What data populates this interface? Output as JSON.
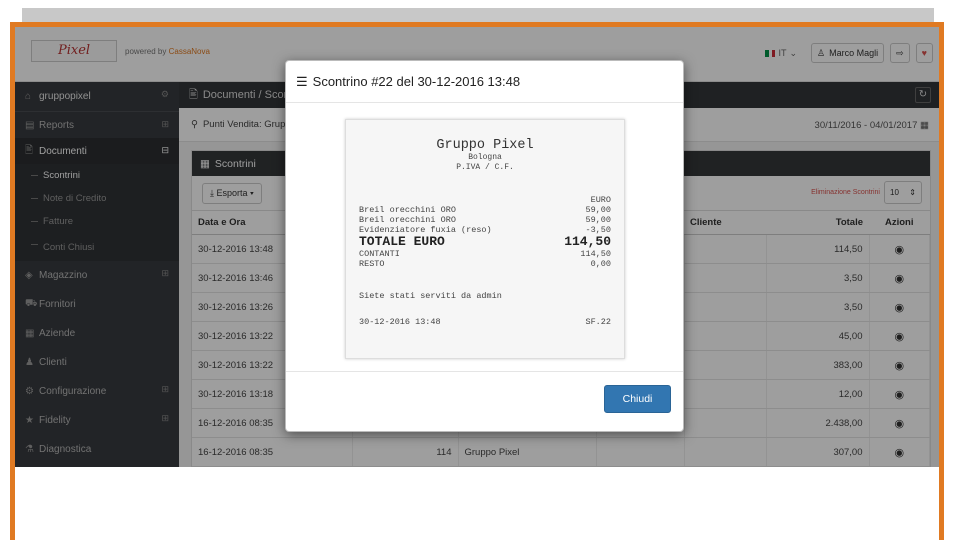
{
  "header": {
    "logo": "Pixel",
    "powered_by": "powered by ",
    "powered_brand": "CassaNova",
    "lang": "IT",
    "user": "Marco Magli"
  },
  "sidebar": {
    "company": "gruppopixel",
    "items": [
      {
        "label": "Reports",
        "icon": "chart-icon"
      },
      {
        "label": "Documenti",
        "icon": "document-icon"
      }
    ],
    "subitems": [
      "Scontrini",
      "Note di Credito",
      "Fatture",
      "Conti Chiusi"
    ],
    "items2": [
      {
        "label": "Magazzino",
        "icon": "boxes-icon",
        "expand": true
      },
      {
        "label": "Fornitori",
        "icon": "truck-icon",
        "expand": false
      },
      {
        "label": "Aziende",
        "icon": "building-icon",
        "expand": false
      },
      {
        "label": "Clienti",
        "icon": "users-icon",
        "expand": false
      },
      {
        "label": "Configurazione",
        "icon": "cogs-icon",
        "expand": true
      },
      {
        "label": "Fidelity",
        "icon": "star-icon",
        "expand": true
      },
      {
        "label": "Diagnostica",
        "icon": "diagnostic-icon",
        "expand": false
      }
    ]
  },
  "content": {
    "breadcrumb": "Documenti / Scontrini",
    "filter_label": "Punti Vendita: Gruppo Pixel",
    "date_range": "30/11/2016 - 04/01/2017",
    "panel_title": "Scontrini",
    "export_label": "Esporta",
    "delete_label": "Eliminazione Scontrini",
    "page_size": "10",
    "columns": [
      "Data e Ora",
      "",
      "",
      "",
      "Cliente",
      "Totale",
      "Azioni"
    ],
    "rows": [
      {
        "date": "30-12-2016 13:48",
        "num": "",
        "pv": "",
        "x": "",
        "client": "",
        "total": "114,50"
      },
      {
        "date": "30-12-2016 13:46",
        "num": "",
        "pv": "",
        "x": "",
        "client": "",
        "total": "3,50"
      },
      {
        "date": "30-12-2016 13:26",
        "num": "",
        "pv": "",
        "x": "",
        "client": "",
        "total": "3,50"
      },
      {
        "date": "30-12-2016 13:22",
        "num": "",
        "pv": "",
        "x": "",
        "client": "",
        "total": "45,00"
      },
      {
        "date": "30-12-2016 13:22",
        "num": "",
        "pv": "",
        "x": "",
        "client": "",
        "total": "383,00"
      },
      {
        "date": "30-12-2016 13:18",
        "num": "",
        "pv": "",
        "x": "",
        "client": "",
        "total": "12,00"
      },
      {
        "date": "16-12-2016 08:35",
        "num": "",
        "pv": "",
        "x": "",
        "client": "",
        "total": "2.438,00"
      },
      {
        "date": "16-12-2016 08:35",
        "num": "114",
        "pv": "Gruppo Pixel",
        "x": "",
        "client": "",
        "total": "307,00"
      }
    ]
  },
  "modal": {
    "title": "Scontrino #22 del 30-12-2016 13:48",
    "receipt": {
      "company": "Gruppo Pixel",
      "city": "Bologna",
      "vat": "P.IVA / C.F.",
      "currency": "EURO",
      "lines": [
        {
          "desc": "Breil orecchini ORO",
          "amount": "59,00"
        },
        {
          "desc": "Breil orecchini ORO",
          "amount": "59,00"
        },
        {
          "desc": "Evidenziatore fuxia (reso)",
          "amount": "-3,50"
        }
      ],
      "total_label": "TOTALE EURO",
      "total": "114,50",
      "cash_label": "CONTANTI",
      "cash": "114,50",
      "change_label": "RESTO",
      "change": "0,00",
      "served": "Siete stati serviti da admin",
      "datetime": "30-12-2016 13:48",
      "code": "SF.22"
    },
    "close_label": "Chiudi"
  }
}
